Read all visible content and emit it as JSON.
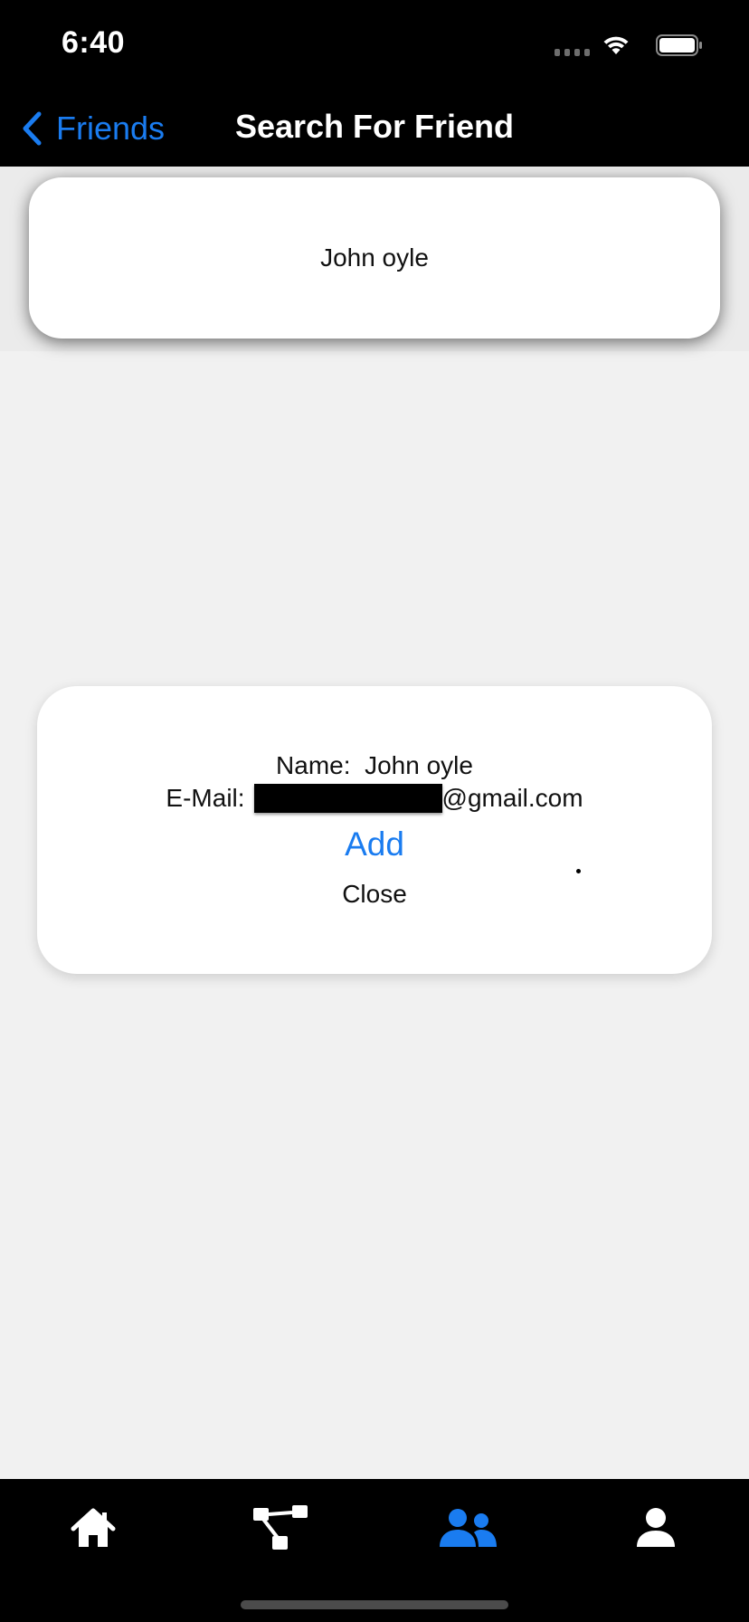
{
  "status_bar": {
    "time": "6:40",
    "icons": [
      "cellular-signal-icon",
      "wifi-icon",
      "battery-icon"
    ]
  },
  "nav": {
    "back_label": "Friends",
    "title": "Search For Friend",
    "accent_color": "#1a7cf0"
  },
  "search_results": [
    {
      "name": "John oyle"
    }
  ],
  "popup": {
    "name_label": "Name:",
    "name_value": "John oyle",
    "email_label": "E-Mail:",
    "email_suffix": "@gmail.com",
    "add_label": "Add",
    "close_label": "Close"
  },
  "tab_bar": {
    "tabs": [
      {
        "icon": "home-icon",
        "active": false
      },
      {
        "icon": "hierarchy-icon",
        "active": false
      },
      {
        "icon": "friends-icon",
        "active": true
      },
      {
        "icon": "profile-icon",
        "active": false
      }
    ],
    "active_color": "#1a7cf0",
    "inactive_color": "#ffffff"
  }
}
